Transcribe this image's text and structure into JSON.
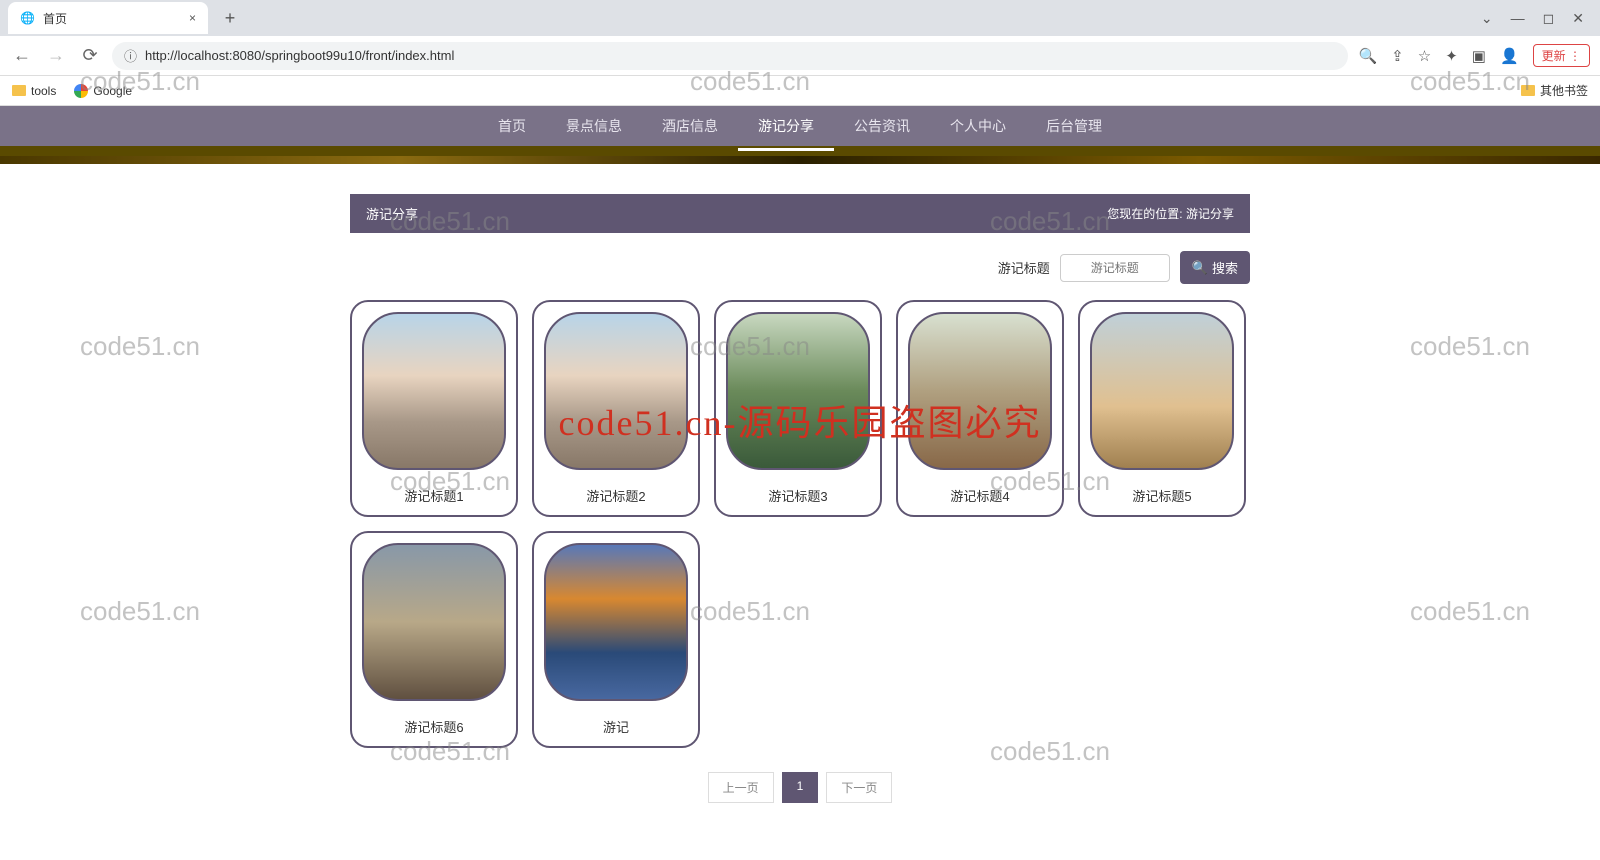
{
  "browser": {
    "tab_title": "首页",
    "url": "http://localhost:8080/springboot99u10/front/index.html",
    "update_label": "更新",
    "bookmarks": {
      "tools": "tools",
      "google": "Google",
      "other": "其他书签"
    }
  },
  "nav": {
    "items": [
      "首页",
      "景点信息",
      "酒店信息",
      "游记分享",
      "公告资讯",
      "个人中心",
      "后台管理"
    ],
    "active_index": 3
  },
  "breadcrumb": {
    "title": "游记分享",
    "location_prefix": "您现在的位置:",
    "location_link": "游记分享"
  },
  "search": {
    "label": "游记标题",
    "placeholder": "游记标题",
    "button": "搜索"
  },
  "cards": [
    {
      "title": "游记标题1",
      "img": "img1"
    },
    {
      "title": "游记标题2",
      "img": "img1"
    },
    {
      "title": "游记标题3",
      "img": "img2"
    },
    {
      "title": "游记标题4",
      "img": "img3"
    },
    {
      "title": "游记标题5",
      "img": "img4"
    },
    {
      "title": "游记标题6",
      "img": "img5"
    },
    {
      "title": "游记",
      "img": "img6"
    }
  ],
  "pagination": {
    "prev": "上一页",
    "current": "1",
    "next": "下一页"
  },
  "watermark": {
    "text": "code51.cn",
    "red": "code51.cn-源码乐园盗图必究"
  }
}
